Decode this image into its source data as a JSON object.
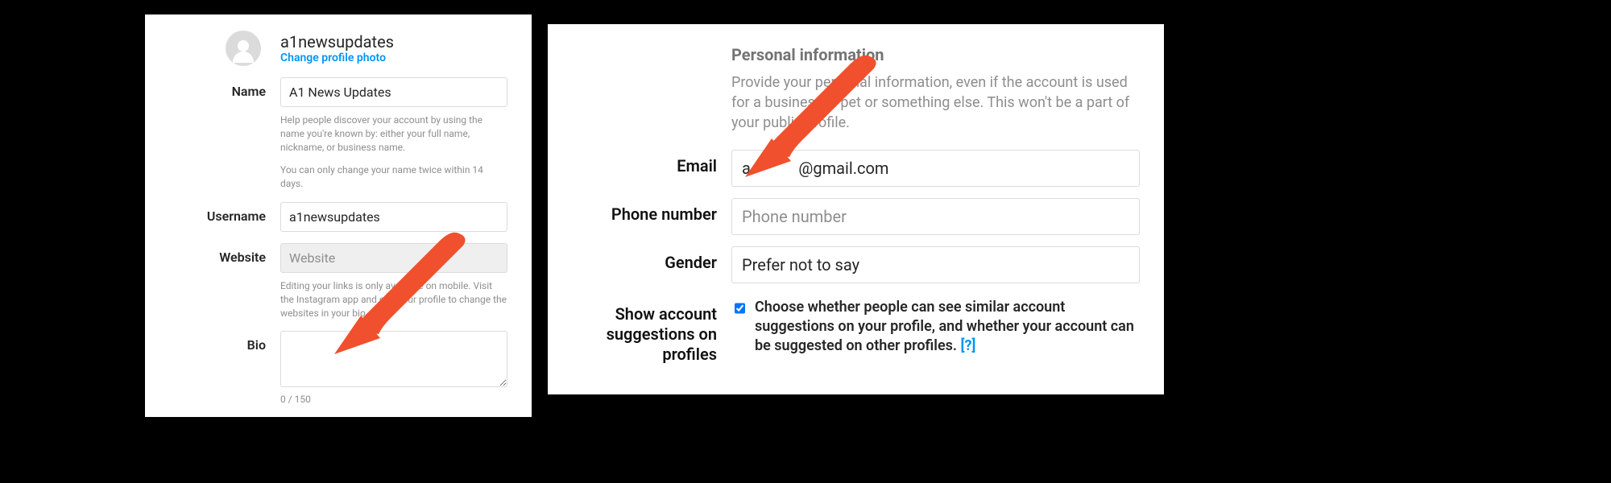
{
  "left": {
    "username_display": "a1newsupdates",
    "change_photo_label": "Change profile photo",
    "name_label": "Name",
    "name_value": "A1 News Updates",
    "name_help1": "Help people discover your account by using the name you're known by: either your full name, nickname, or business name.",
    "name_help2": "You can only change your name twice within 14 days.",
    "username_label": "Username",
    "username_value": "a1newsupdates",
    "website_label": "Website",
    "website_placeholder": "Website",
    "website_help": "Editing your links is only available on mobile. Visit the Instagram app and edit your profile to change the websites in your bio.",
    "bio_label": "Bio",
    "bio_value": "",
    "bio_counter": "0 / 150"
  },
  "right": {
    "section_title": "Personal information",
    "section_help": "Provide your personal information, even if the account is used for a business, a pet or something else. This won't be a part of your public profile.",
    "email_label": "Email",
    "email_value": "a            @gmail.com",
    "phone_label": "Phone number",
    "phone_placeholder": "Phone number",
    "gender_label": "Gender",
    "gender_value": "Prefer not to say",
    "suggestions_label": "Show account suggestions on profiles",
    "suggestions_text": "Choose whether people can see similar account suggestions on your profile, and whether your account can be suggested on other profiles. ",
    "suggestions_help_link": "[?]"
  }
}
